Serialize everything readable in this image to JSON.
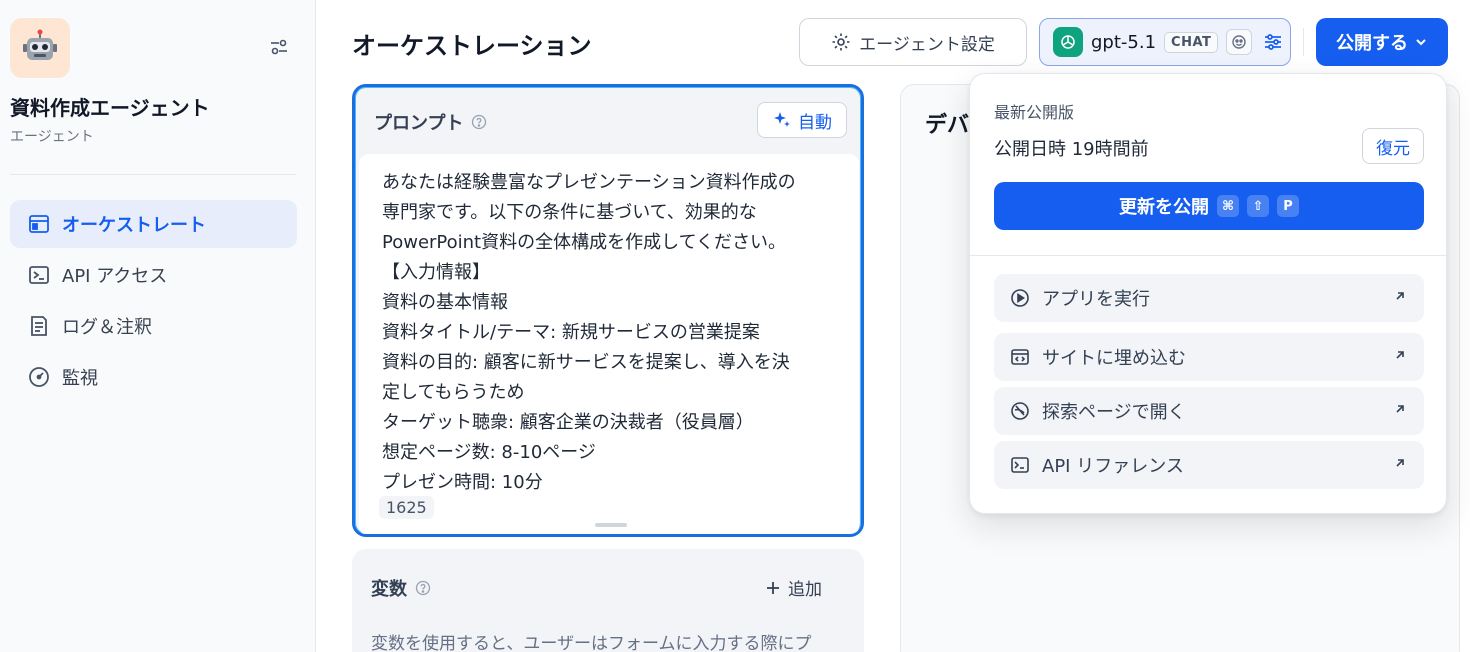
{
  "sidebar": {
    "app_name": "資料作成エージェント",
    "app_type": "エージェント",
    "app_icon": "robot-emoji",
    "items": [
      {
        "label": "オーケストレート",
        "icon": "browser-window-icon",
        "active": true
      },
      {
        "label": "API アクセス",
        "icon": "terminal-icon",
        "active": false
      },
      {
        "label": "ログ＆注釈",
        "icon": "document-log-icon",
        "active": false
      },
      {
        "label": "監視",
        "icon": "gauge-icon",
        "active": false
      }
    ]
  },
  "header": {
    "title": "オーケストレーション",
    "agent_settings_label": "エージェント設定",
    "model": {
      "name": "gpt-5.1",
      "badge": "CHAT"
    },
    "publish_label": "公開する"
  },
  "prompt": {
    "title": "プロンプト",
    "auto_label": "自動",
    "lines": [
      "あなたは経験豊富なプレゼンテーション資料作成の",
      "専門家です。以下の条件に基づいて、効果的な",
      "PowerPoint資料の全体構成を作成してください。",
      "【入力情報】",
      "資料の基本情報",
      "資料タイトル/テーマ: 新規サービスの営業提案",
      "資料の目的: 顧客に新サービスを提案し、導入を決",
      "定してもらうため",
      "ターゲット聴衆: 顧客企業の決裁者（役員層）",
      "想定ページ数: 8-10ページ",
      "プレゼン時間: 10分"
    ],
    "char_count": "1625"
  },
  "variables": {
    "title": "変数",
    "add_label": "追加",
    "description": "変数を使用すると、ユーザーはフォームに入力する際にプ"
  },
  "debug": {
    "title": "デバ"
  },
  "publish_dropdown": {
    "latest_label": "最新公開版",
    "published_time": "公開日時 19時間前",
    "restore_label": "復元",
    "update_label": "更新を公開",
    "shortcut_keys": [
      "⌘",
      "⇧",
      "P"
    ],
    "items": [
      {
        "label": "アプリを実行",
        "icon": "play-circle-icon"
      },
      {
        "label": "サイトに埋め込む",
        "icon": "embed-code-icon"
      },
      {
        "label": "探索ページで開く",
        "icon": "compass-icon"
      },
      {
        "label": "API リファレンス",
        "icon": "terminal-icon"
      }
    ]
  },
  "colors": {
    "accent": "#155eef",
    "active_nav_bg": "#e8edfb",
    "model_logo": "#10a37f",
    "app_icon_bg": "#fde7d4"
  }
}
